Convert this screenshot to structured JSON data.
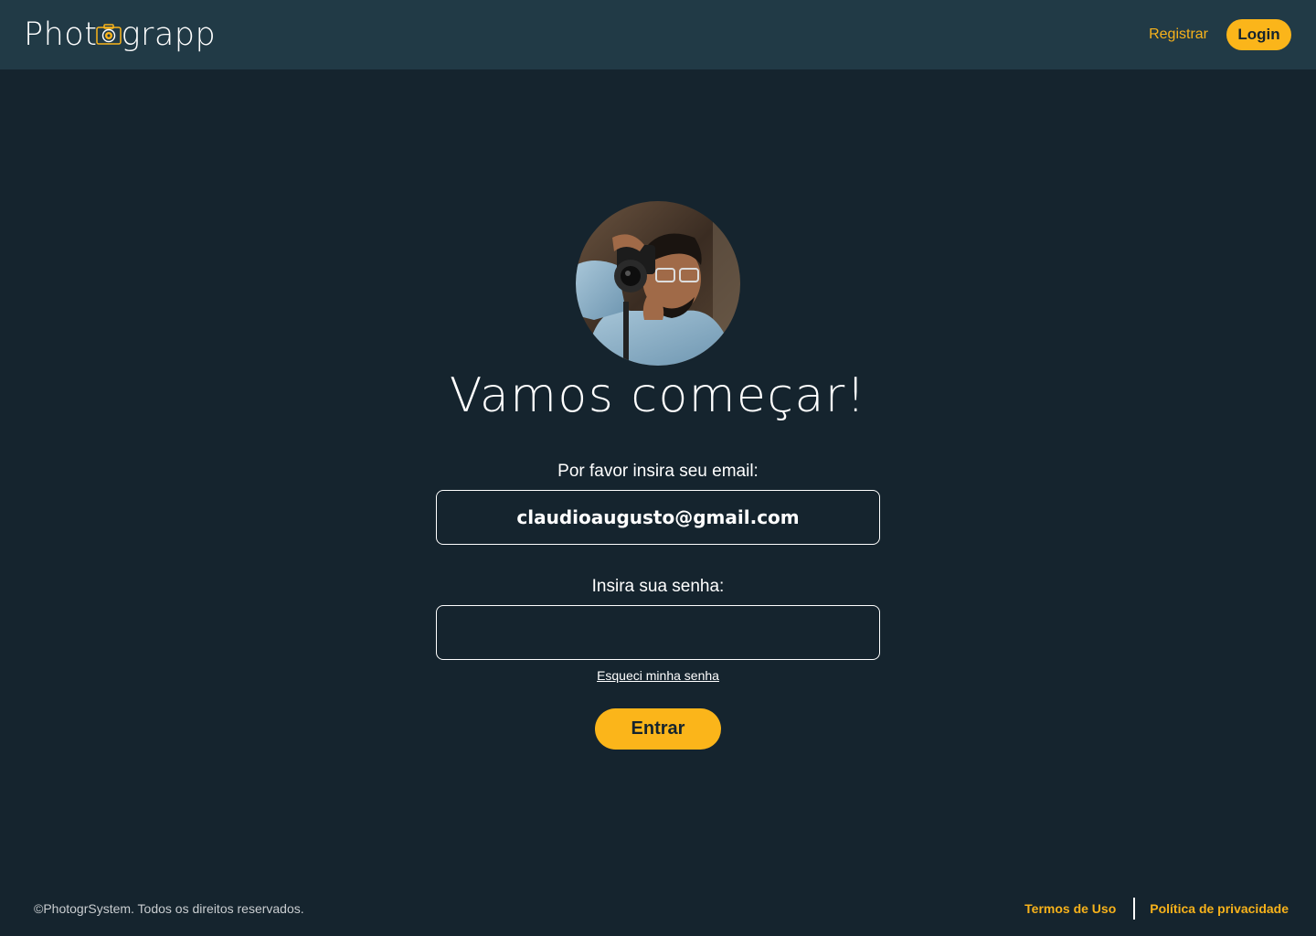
{
  "header": {
    "logo_left": "Phot",
    "logo_right": "grapp",
    "register_label": "Registrar",
    "login_label": "Login"
  },
  "main": {
    "title": "Vamos começar!",
    "email_label": "Por favor insira seu email:",
    "email_value": "claudioaugusto@gmail.com",
    "password_label": "Insira sua senha:",
    "password_value": "",
    "forgot_label": "Esqueci minha senha",
    "submit_label": "Entrar"
  },
  "footer": {
    "copyright": "©PhotogrSystem. Todos os direitos reservados.",
    "terms_label": "Termos de Uso",
    "privacy_label": "Política de privacidade"
  },
  "colors": {
    "background": "#15242e",
    "header": "#213a46",
    "accent": "#fbb51a"
  },
  "icons": {
    "logo": "camera-icon",
    "avatar": "user-avatar-photo"
  }
}
